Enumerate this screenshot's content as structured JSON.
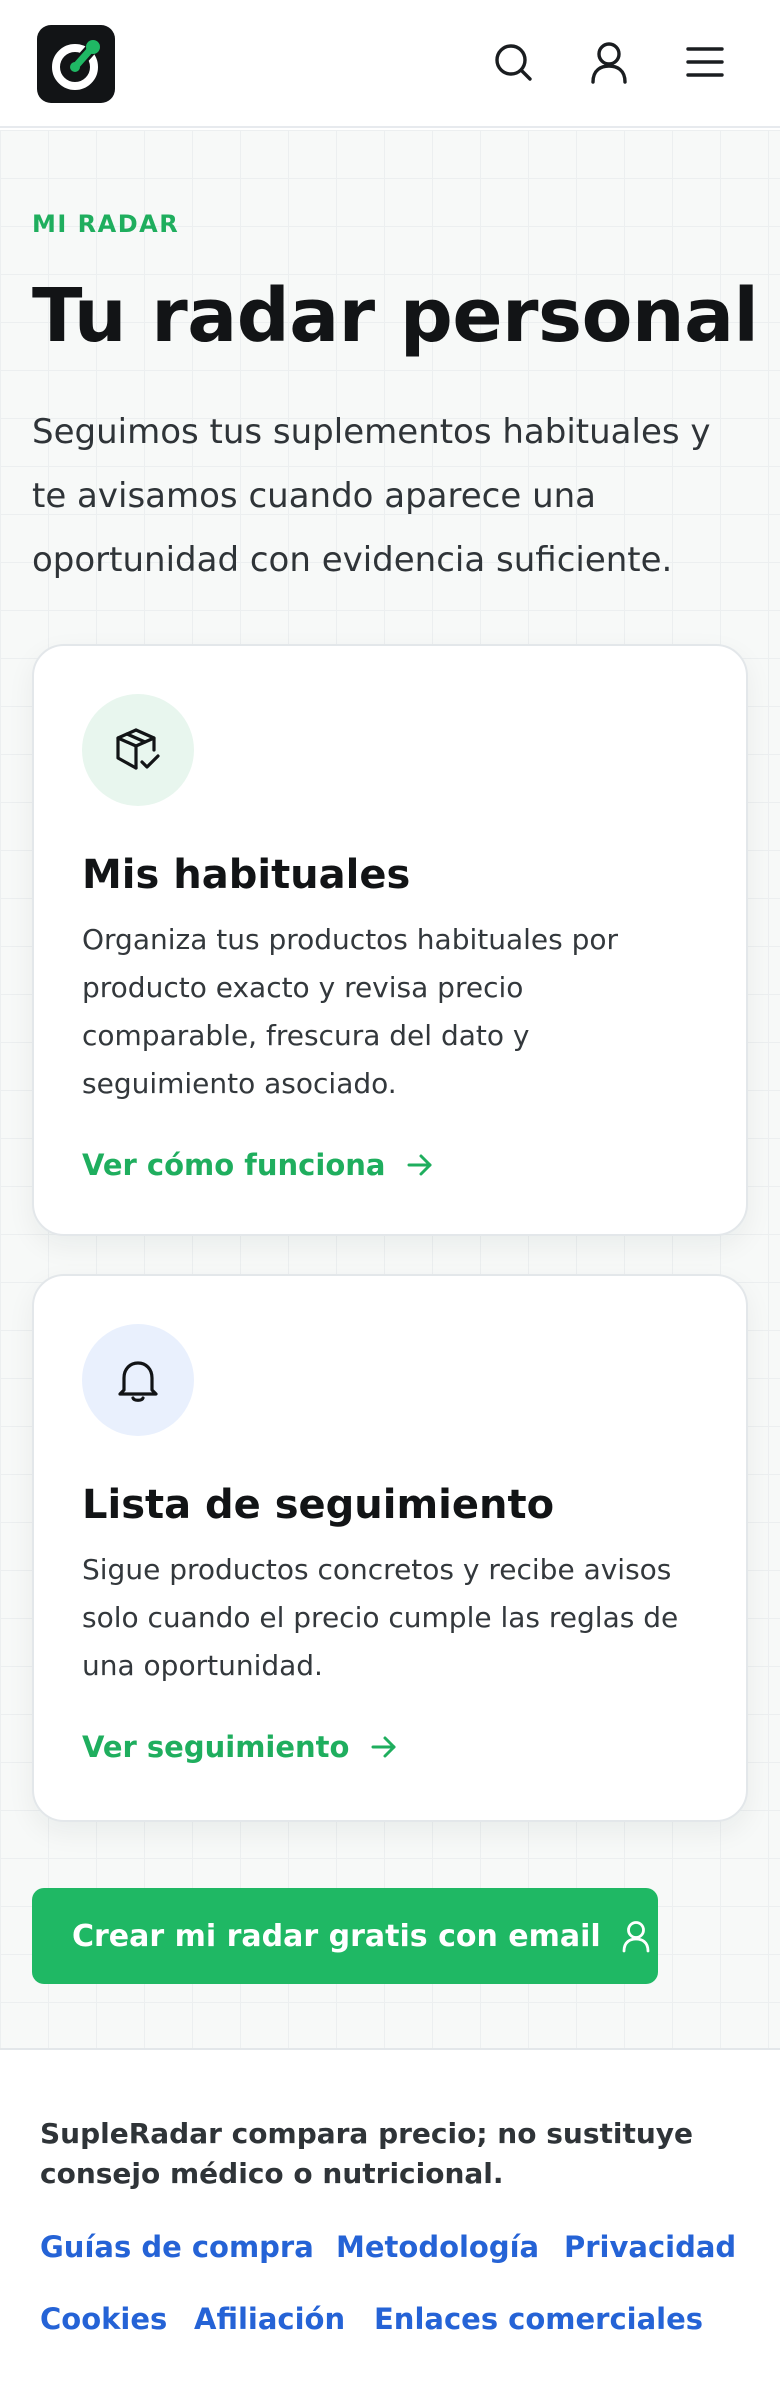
{
  "header": {
    "logo": "supleradar-logo",
    "icons": [
      "search-icon",
      "user-icon",
      "menu-icon"
    ]
  },
  "hero": {
    "eyebrow": "MI RADAR",
    "title": "Tu radar personal",
    "lead": "Seguimos tus suplementos habituales y te avisamos cuando aparece una oportunidad con evidencia suficiente."
  },
  "cards": [
    {
      "icon": "package-check-icon",
      "icon_bg": "#e8f6ee",
      "title": "Mis habituales",
      "text": "Organiza tus productos habituales por producto exacto y revisa precio comparable, frescura del dato y seguimiento asociado.",
      "link": "Ver cómo funciona"
    },
    {
      "icon": "bell-icon",
      "icon_bg": "#e9f0fd",
      "title": "Lista de seguimiento",
      "text": "Sigue productos concretos y recibe avisos solo cuando el precio cumple las reglas de una oportunidad.",
      "link": "Ver seguimiento"
    }
  ],
  "cta": {
    "label": "Crear mi radar gratis con email",
    "icon": "user-icon"
  },
  "footer": {
    "disclaimer": "SupleRadar compara precio; no sustituye consejo médico o nutricional.",
    "links": [
      "Guías de compra",
      "Metodología",
      "Privacidad",
      "Cookies",
      "Afiliación",
      "Enlaces comerciales"
    ]
  },
  "colors": {
    "accent_green": "#1fae5e",
    "cta_green": "#1fb864",
    "link_blue": "#2563d6",
    "ink": "#121416"
  }
}
